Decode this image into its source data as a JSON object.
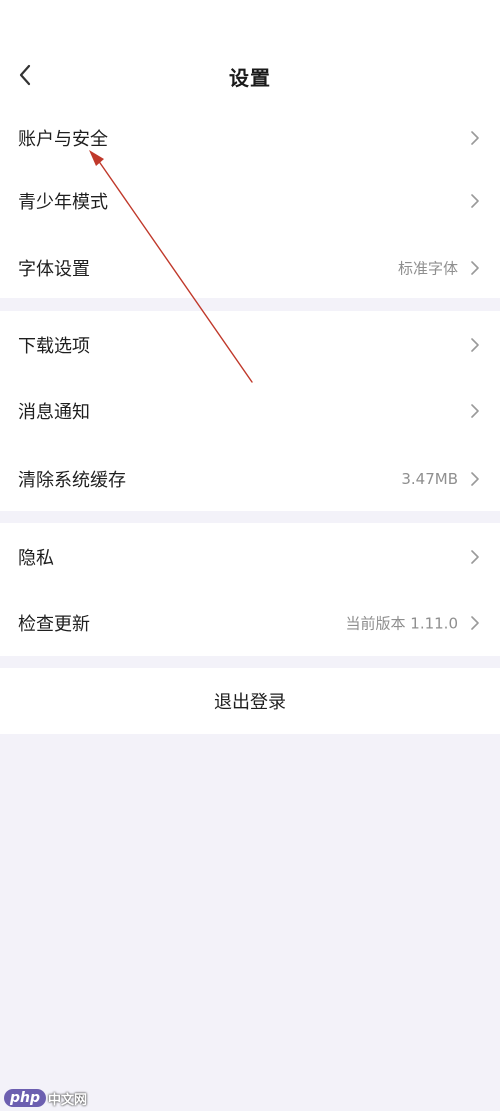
{
  "header": {
    "title": "设置"
  },
  "sections": [
    {
      "rows": [
        {
          "label": "账户与安全",
          "value": ""
        },
        {
          "label": "青少年模式",
          "value": ""
        },
        {
          "label": "字体设置",
          "value": "标准字体"
        }
      ]
    },
    {
      "rows": [
        {
          "label": "下载选项",
          "value": ""
        },
        {
          "label": "消息通知",
          "value": ""
        },
        {
          "label": "清除系统缓存",
          "value": "3.47MB"
        }
      ]
    },
    {
      "rows": [
        {
          "label": "隐私",
          "value": ""
        },
        {
          "label": "检查更新",
          "value": "当前版本 1.11.0"
        }
      ]
    }
  ],
  "logout": {
    "label": "退出登录"
  },
  "watermark": {
    "logo": "php",
    "text": "中文网"
  },
  "colors": {
    "background": "#f3f2f9",
    "card": "#ffffff",
    "text": "#1f1f1f",
    "secondary_text": "#8f8f8f",
    "annotation_arrow": "#c0392b"
  },
  "icons": {
    "back": "chevron-left-icon",
    "row_arrow": "chevron-right-icon"
  }
}
